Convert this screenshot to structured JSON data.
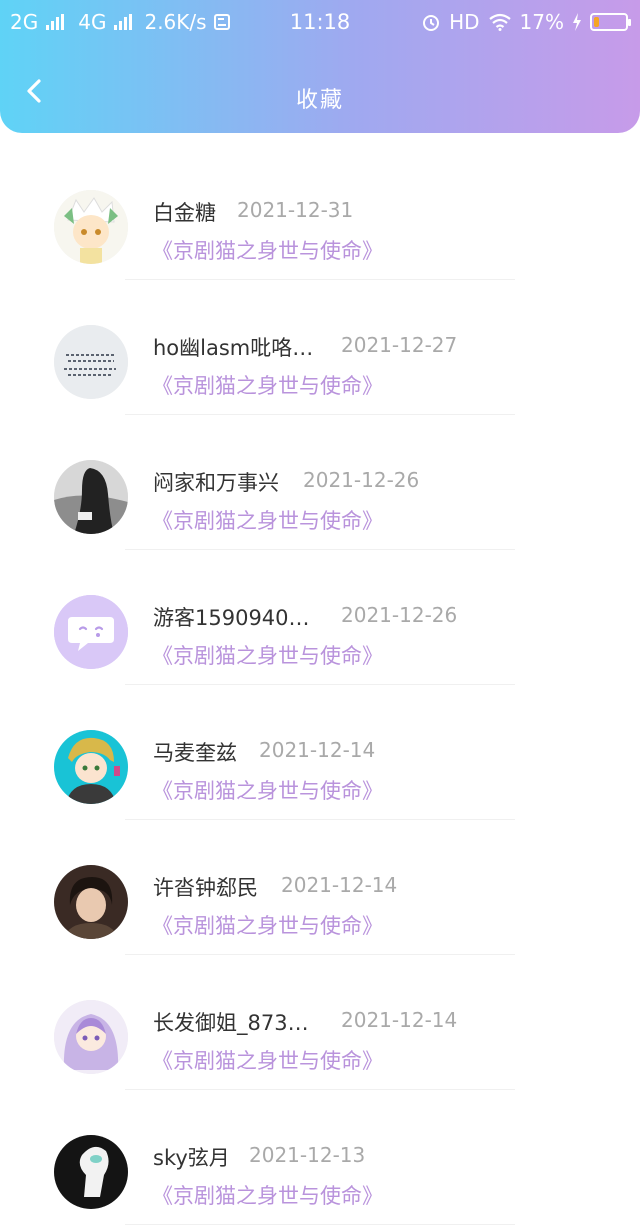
{
  "status_bar": {
    "left": [
      "2G",
      "4G",
      "2.6K/s"
    ],
    "time": "11:18",
    "hd": "HD",
    "battery": "17%",
    "battery_level": 0.17
  },
  "header": {
    "title": "收藏"
  },
  "items": [
    {
      "name": "白金糖",
      "date": "2021-12-31",
      "work": "《京剧猫之身世与使命》",
      "avatar": "anime-white-hair"
    },
    {
      "name": "ho幽lasm吡咯…",
      "date": "2021-12-27",
      "work": "《京剧猫之身世与使命》",
      "avatar": "calligraphy"
    },
    {
      "name": "闷家和万事兴",
      "date": "2021-12-26",
      "work": "《京剧猫之身世与使命》",
      "avatar": "dark-figure"
    },
    {
      "name": "游客1590940…",
      "date": "2021-12-26",
      "work": "《京剧猫之身世与使命》",
      "avatar": "default-chat"
    },
    {
      "name": "马麦奎兹",
      "date": "2021-12-14",
      "work": "《京剧猫之身世与使命》",
      "avatar": "anime-boy-cyan"
    },
    {
      "name": "许沓钟郄民",
      "date": "2021-12-14",
      "work": "《京剧猫之身世与使命》",
      "avatar": "photo-person"
    },
    {
      "name": "长发御姐_873…",
      "date": "2021-12-14",
      "work": "《京剧猫之身世与使命》",
      "avatar": "anime-girl-purple"
    },
    {
      "name": "sky弦月",
      "date": "2021-12-13",
      "work": "《京剧猫之身世与使命》",
      "avatar": "dark-character"
    }
  ]
}
